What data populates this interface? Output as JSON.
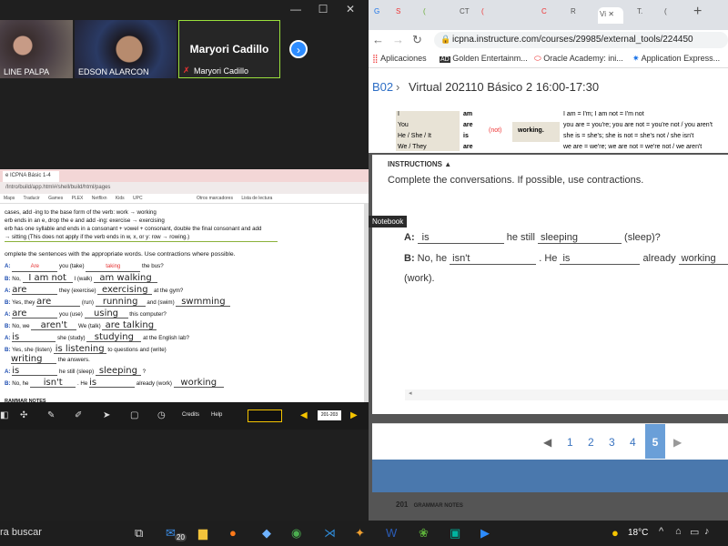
{
  "meeting": {
    "participants": [
      {
        "name": "LINE PALPA"
      },
      {
        "name": "EDSON ALARCON"
      },
      {
        "name": "Maryori Cadillo",
        "label": "Maryori Cadillo"
      }
    ],
    "next_icon": "chevron-right-icon"
  },
  "shared_screen": {
    "tab_label": "e ICPNA Básic 1-4",
    "url": "/Intro/build/app.html#/shell/build/html/pages",
    "bookmarks": [
      "Maps",
      "Traducir",
      "Games",
      "PLEX",
      "Netflixn",
      "Kids",
      "UPC",
      "Otros marcadores",
      "Lista de lectura"
    ],
    "rules": [
      "cases, add -ing to the base form of the verb: work → working",
      "erb ends in an e, drop the e and add -ing: exercise → exercising",
      "erb has one syllable and ends in a consonant + vowel + consonant, double the final consonant and add",
      "→ sitting (This does not apply if the verb ends in w, x, or y: row → rowing.)"
    ],
    "instruction": "omplete the sentences with the appropriate words. Use contractions where possible.",
    "exercises": [
      {
        "letter": "A:",
        "parts": [
          "",
          "you (take)",
          "the bus?"
        ],
        "answers": [
          "Are",
          "taking"
        ]
      },
      {
        "letter": "B:",
        "parts": [
          "No,",
          "I (walk)",
          ""
        ],
        "answers": [
          "I am not",
          "am walking"
        ]
      },
      {
        "letter": "A:",
        "parts": [
          "",
          "they (exercise)",
          "at the gym?"
        ],
        "answers": [
          "are",
          "exercising"
        ]
      },
      {
        "letter": "B:",
        "parts": [
          "Yes, they",
          "(run)",
          "and (swim)"
        ],
        "answers": [
          "are",
          "running",
          "swmming"
        ]
      },
      {
        "letter": "A:",
        "parts": [
          "",
          "you (use)",
          "this computer?"
        ],
        "answers": [
          "are",
          "using"
        ]
      },
      {
        "letter": "B:",
        "parts": [
          "No, we",
          "We (talk)",
          ""
        ],
        "answers": [
          "aren't",
          "are talking"
        ]
      },
      {
        "letter": "A:",
        "parts": [
          "",
          "she (study)",
          "at the English lab?"
        ],
        "answers": [
          "is",
          "studying"
        ]
      },
      {
        "letter": "B:",
        "parts": [
          "Yes, she (listen)",
          "to questions and (write)",
          "the answers."
        ],
        "answers": [
          "is listening",
          "writing"
        ]
      },
      {
        "letter": "A:",
        "parts": [
          "",
          "he still (sleep)",
          "?"
        ],
        "answers": [
          "is",
          "sleeping"
        ]
      },
      {
        "letter": "B:",
        "parts": [
          "No, he",
          ". He",
          "already (work)"
        ],
        "answers": [
          "isn't",
          "is",
          "working"
        ]
      }
    ],
    "footer": "RAMMAR NOTES",
    "toolbar": {
      "credits": "Credits",
      "help": "Help",
      "page": "201-203"
    }
  },
  "chrome": {
    "tabs": [
      "G",
      "S",
      "(",
      "CT",
      "(",
      "C",
      "R",
      "Vi",
      "T.",
      "("
    ],
    "url": "icpna.instructure.com/courses/29985/external_tools/224450",
    "bookmarks": [
      "Aplicaciones",
      "Golden Entertainm...",
      "Oracle Academy: ini...",
      "Application Express..."
    ],
    "breadcrumb": {
      "link": "B02",
      "current": "Virtual 202110 Básico 2 16:00-17:30"
    },
    "grammar_table": {
      "rows": [
        {
          "subject": "I",
          "verb": "am",
          "right": "I am = I'm; I am not = I'm not"
        },
        {
          "subject": "You",
          "verb": "are",
          "right": "you are = you're; you are not = you're not / you aren't"
        },
        {
          "subject": "He / She / It",
          "verb": "is",
          "right": "she is = she's; she is not = she's not / she isn't"
        },
        {
          "subject": "We / They",
          "verb": "are",
          "right": "we are = we're; we are not = we're not / we aren't"
        }
      ],
      "neg": "(not)",
      "verb_ing": "working."
    },
    "modal": {
      "heading": "INSTRUCTIONS ▲",
      "instruction": "Complete the conversations. If possible, use contractions.",
      "line_a": {
        "letter": "A:",
        "blank1": "is",
        "middle": "he still",
        "blank2": "sleeping",
        "end": "(sleep)?"
      },
      "line_b": {
        "letter": "B:",
        "start": "No, he",
        "blank1": "isn't",
        "middle": ". He",
        "blank2": "is",
        "after": "already",
        "blank3": "working"
      },
      "line_c": "(work)."
    },
    "notebook_tip": "Notebook",
    "pager": {
      "pages": [
        "1",
        "2",
        "3",
        "4",
        "5"
      ],
      "current": "5"
    },
    "page_footer": {
      "num": "201",
      "label": "GRAMMAR NOTES"
    }
  },
  "taskbar": {
    "search": "ra buscar",
    "mail_badge": "20",
    "temperature": "18°C"
  }
}
